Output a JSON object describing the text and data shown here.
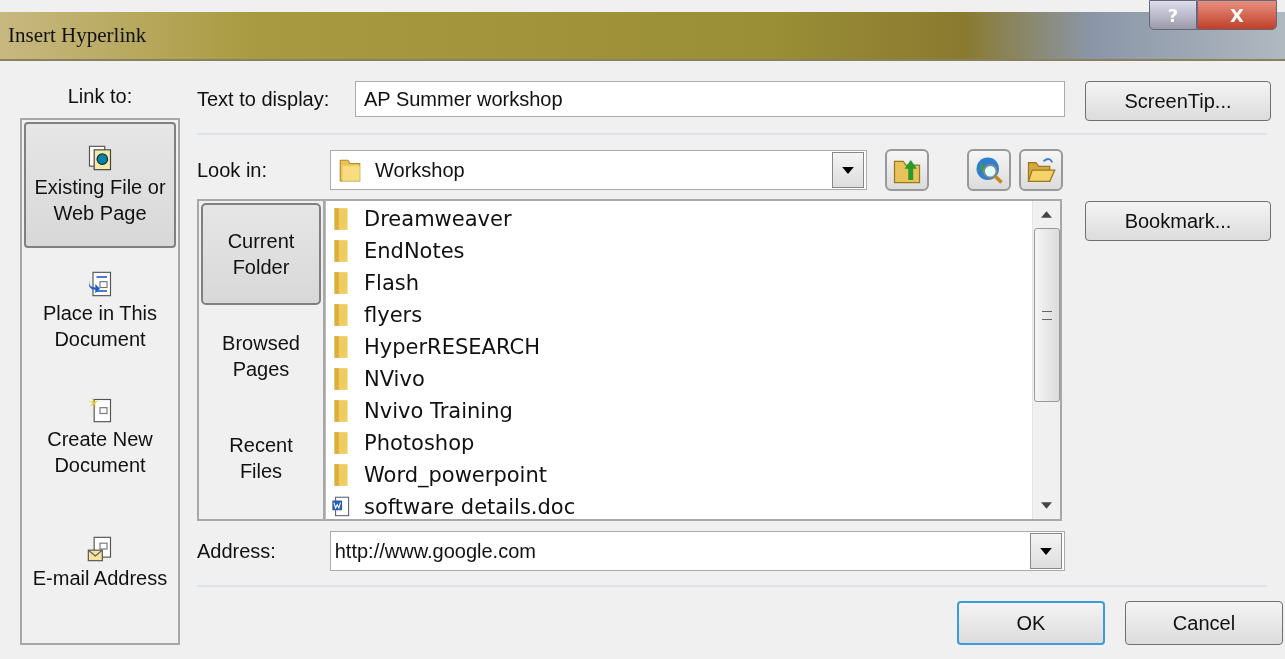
{
  "window": {
    "title": "Insert Hyperlink",
    "controls": [
      "?",
      "X"
    ]
  },
  "link_to": {
    "label": "Link to:",
    "items": [
      {
        "label": "Existing File or Web Page",
        "kind": "file",
        "selected": true
      },
      {
        "label": "Place in This Document",
        "kind": "place",
        "selected": false
      },
      {
        "label": "Create New Document",
        "kind": "new",
        "selected": false
      },
      {
        "label": "E-mail Address",
        "kind": "email",
        "selected": false
      }
    ]
  },
  "text_to_display": {
    "label": "Text to display:",
    "value": "AP Summer workshop"
  },
  "screentip_button": "ScreenTip...",
  "look_in": {
    "label": "Look in:",
    "value": "Workshop"
  },
  "places": [
    {
      "label": "Current Folder",
      "selected": true
    },
    {
      "label": "Browsed Pages",
      "selected": false
    },
    {
      "label": "Recent Files",
      "selected": false
    }
  ],
  "files": [
    {
      "name": "Dreamweaver",
      "kind": "folder"
    },
    {
      "name": "EndNotes",
      "kind": "folder"
    },
    {
      "name": "Flash",
      "kind": "folder"
    },
    {
      "name": "flyers",
      "kind": "folder"
    },
    {
      "name": "HyperRESEARCH",
      "kind": "folder"
    },
    {
      "name": "NVivo",
      "kind": "folder"
    },
    {
      "name": "Nvivo Training",
      "kind": "folder"
    },
    {
      "name": "Photoshop",
      "kind": "folder"
    },
    {
      "name": "Word_powerpoint",
      "kind": "folder"
    },
    {
      "name": "software details.doc",
      "kind": "doc"
    }
  ],
  "bookmark_button": "Bookmark...",
  "address": {
    "label": "Address:",
    "value": "http://www.google.com"
  },
  "buttons": [
    {
      "label": "OK",
      "default": true
    },
    {
      "label": "Cancel",
      "default": false
    }
  ]
}
